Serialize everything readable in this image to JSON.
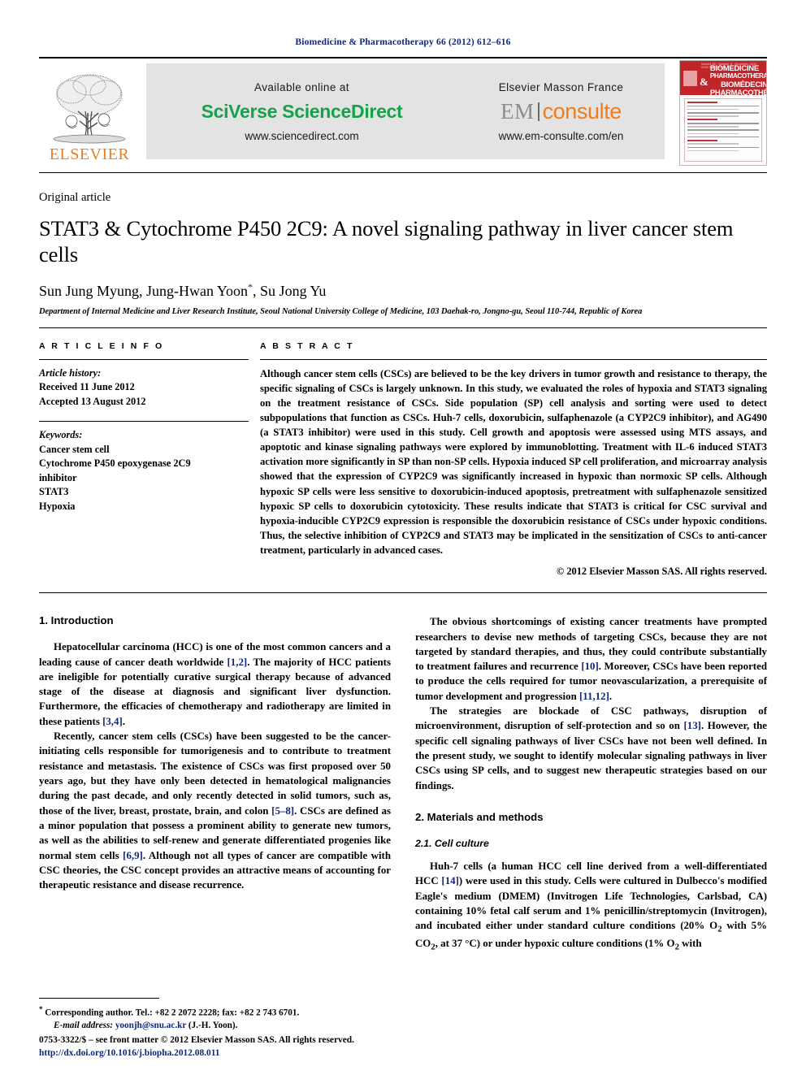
{
  "running_head": "Biomedicine & Pharmacotherapy 66 (2012) 612–616",
  "masthead": {
    "publisher_logo_text": "ELSEVIER",
    "available_online_text": "Available online at",
    "sciencedirect_logo": "SciVerse ScienceDirect",
    "sciencedirect_url": "www.sciencedirect.com",
    "masson_text": "Elsevier Masson France",
    "em_logo_left": "EM",
    "em_logo_right": "consulte",
    "em_url": "www.em-consulte.com/en",
    "cover": {
      "issue_line": "Volume 66 · Number 8 · December 2012 · ISSN 0753-3322",
      "amp": "&",
      "title_line1": "BIOMEDICINE",
      "title_line2": "PHARMACOTHERAPY",
      "subtitle": "BIOMÉDECINE & PHARMACOTHÉRAPIE"
    }
  },
  "article": {
    "type": "Original article",
    "title": "STAT3 & Cytochrome P450 2C9: A novel signaling pathway in liver cancer stem cells",
    "authors": "Sun Jung Myung, Jung-Hwan Yoon",
    "authors_tail": ", Su Jong Yu",
    "corresponding_marker": "*",
    "affiliation": "Department of Internal Medicine and Liver Research Institute, Seoul National University College of Medicine, 103 Daehak-ro, Jongno-gu, Seoul 110-744, Republic of Korea"
  },
  "article_info": {
    "heading": "A R T I C L E   I N F O",
    "history_label": "Article history:",
    "received": "Received 11 June 2012",
    "accepted": "Accepted 13 August 2012",
    "keywords_label": "Keywords:",
    "keywords": [
      "Cancer stem cell",
      "Cytochrome P450 epoxygenase 2C9",
      "inhibitor",
      "STAT3",
      "Hypoxia"
    ]
  },
  "abstract": {
    "heading": "A B S T R A C T",
    "text": "Although cancer stem cells (CSCs) are believed to be the key drivers in tumor growth and resistance to therapy, the specific signaling of CSCs is largely unknown. In this study, we evaluated the roles of hypoxia and STAT3 signaling on the treatment resistance of CSCs. Side population (SP) cell analysis and sorting were used to detect subpopulations that function as CSCs. Huh-7 cells, doxorubicin, sulfaphenazole (a CYP2C9 inhibitor), and AG490 (a STAT3 inhibitor) were used in this study. Cell growth and apoptosis were assessed using MTS assays, and apoptotic and kinase signaling pathways were explored by immunoblotting. Treatment with IL-6 induced STAT3 activation more significantly in SP than non-SP cells. Hypoxia induced SP cell proliferation, and microarray analysis showed that the expression of CYP2C9 was significantly increased in hypoxic than normoxic SP cells. Although hypoxic SP cells were less sensitive to doxorubicin-induced apoptosis, pretreatment with sulfaphenazole sensitized hypoxic SP cells to doxorubicin cytotoxicity. These results indicate that STAT3 is critical for CSC survival and hypoxia-inducible CYP2C9 expression is responsible the doxorubicin resistance of CSCs under hypoxic conditions. Thus, the selective inhibition of CYP2C9 and STAT3 may be implicated in the sensitization of CSCs to anti-cancer treatment, particularly in advanced cases.",
    "copyright": "© 2012 Elsevier Masson SAS. All rights reserved."
  },
  "sections": {
    "introduction_heading": "1. Introduction",
    "intro_p1_a": "Hepatocellular carcinoma (HCC) is one of the most common cancers and a leading cause of cancer death worldwide ",
    "intro_p1_ref1": "[1,2]",
    "intro_p1_b": ". The majority of HCC patients are ineligible for potentially curative surgical therapy because of advanced stage of the disease at diagnosis and significant liver dysfunction. Furthermore, the efficacies of chemotherapy and radiotherapy are limited in these patients ",
    "intro_p1_ref2": "[3,4]",
    "intro_p1_c": ".",
    "intro_p2_a": "Recently, cancer stem cells (CSCs) have been suggested to be the cancer-initiating cells responsible for tumorigenesis and to contribute to treatment resistance and metastasis. The existence of CSCs was first proposed over 50 years ago, but they have only been detected in hematological malignancies during the past decade, and only recently detected in solid tumors, such as, those of the liver, breast, prostate, brain, and colon ",
    "intro_p2_ref1": "[5–8]",
    "intro_p2_b": ". CSCs are defined as a minor population that possess a prominent ability to generate new tumors, as well as the abilities to self-renew and generate differentiated progenies like normal stem cells ",
    "intro_p2_ref2": "[6,9]",
    "intro_p2_c": ". Although not all types of cancer are compatible with CSC theories, the CSC concept provides an attractive means of accounting for therapeutic resistance and disease recurrence.",
    "intro_p3_a": "The obvious shortcomings of existing cancer treatments have prompted researchers to devise new methods of targeting CSCs, because they are not targeted by standard therapies, and thus, they could contribute substantially to treatment failures and recurrence ",
    "intro_p3_ref1": "[10]",
    "intro_p3_b": ". Moreover, CSCs have been reported to produce the cells required for tumor neovascularization, a prerequisite of tumor development and progression ",
    "intro_p3_ref2": "[11,12]",
    "intro_p3_c": ".",
    "intro_p4_a": "The strategies are blockade of CSC pathways, disruption of microenvironment, disruption of self-protection and so on ",
    "intro_p4_ref1": "[13]",
    "intro_p4_b": ". However, the specific cell signaling pathways of liver CSCs have not been well defined. In the present study, we sought to identify molecular signaling pathways in liver CSCs using SP cells, and to suggest new therapeutic strategies based on our findings.",
    "materials_heading": "2. Materials and methods",
    "cellculture_heading": "2.1. Cell culture",
    "cellculture_a": "Huh-7 cells (a human HCC cell line derived from a well-differentiated HCC ",
    "cellculture_ref1": "[14]",
    "cellculture_b": ") were used in this study. Cells were cultured in Dulbecco's modified Eagle's medium (DMEM) (Invitrogen Life Technologies, Carlsbad, CA) containing 10% fetal calf serum and 1% penicillin/streptomycin (Invitrogen), and incubated either under standard culture conditions (20% O",
    "cellculture_sub1": "2",
    "cellculture_c": " with 5% CO",
    "cellculture_sub2": "2",
    "cellculture_d": ", at 37 °C) or under hypoxic culture conditions (1% O",
    "cellculture_sub3": "2",
    "cellculture_e": " with"
  },
  "footnotes": {
    "corresponding_star": "*",
    "corresponding_text": " Corresponding author. Tel.: +82 2 2072 2228; fax: +82 2 743 6701.",
    "email_label": "E-mail address:",
    "email": "yoonjh@snu.ac.kr",
    "email_tail": " (J.-H. Yoon)."
  },
  "imprint": {
    "issn_line": "0753-3322/$ – see front matter © 2012 Elsevier Masson SAS. All rights reserved.",
    "doi": "http://dx.doi.org/10.1016/j.biopha.2012.08.011"
  },
  "colors": {
    "journal_blue": "#13277a",
    "elsevier_orange": "#f07c1a",
    "sciencedirect_green": "#19a04b",
    "cover_red": "#c0252a"
  }
}
